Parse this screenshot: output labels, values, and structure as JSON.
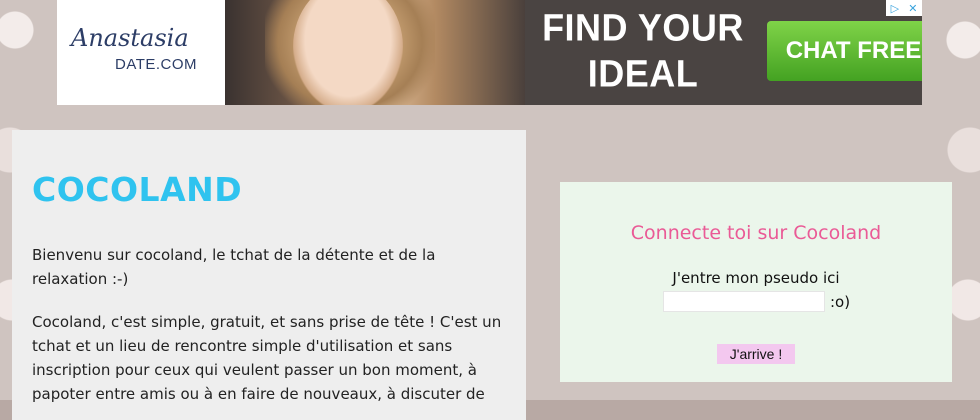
{
  "ad": {
    "brand_script": "Anastasia",
    "brand_domain": "DATE.COM",
    "headline_line1": "FIND YOUR",
    "headline_line2": "IDEAL MATCH",
    "cta_label": "CHAT FREE",
    "cta_icon": "chevron-right-icon",
    "adchoices_icons": [
      "adchoices-icon",
      "close-icon"
    ]
  },
  "main": {
    "title": "COCOLAND",
    "paragraph1": "Bienvenu sur cocoland, le tchat de la détente et de la relaxation :-)",
    "paragraph2": "Cocoland, c'est simple, gratuit, et sans prise de tête ! C'est un tchat et un lieu de rencontre simple d'utilisation et sans inscription pour ceux qui veulent passer un bon moment, à papoter entre amis ou à en faire de nouveaux, à discuter de"
  },
  "login": {
    "title": "Connecte toi sur Cocoland",
    "pseudo_label": "J'entre mon pseudo ici",
    "pseudo_value": "",
    "smiley": ":o)",
    "submit_label": "J'arrive !"
  },
  "colors": {
    "title_blue": "#2fc3ef",
    "login_pink": "#ea5a96",
    "cta_green": "#5cbf2a",
    "button_pink": "#f3c8ef",
    "login_bg": "#ebf6eb"
  }
}
